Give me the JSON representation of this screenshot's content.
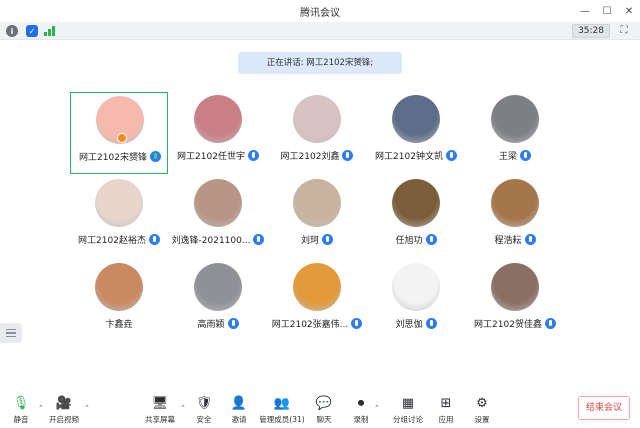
{
  "window": {
    "title": "腾讯会议"
  },
  "status": {
    "timer": "35:28"
  },
  "speaking": {
    "text": "正在讲话: 网工2102宋赟锋;"
  },
  "participants": [
    {
      "name": "网工2102宋赟锋",
      "avatar_color": "#f6b9ae",
      "mic": "green",
      "active": true,
      "host": true
    },
    {
      "name": "网工2102任世宇",
      "avatar_color": "#c97f86",
      "mic": "blue"
    },
    {
      "name": "网工2102刘鑫",
      "avatar_color": "#d8c2c2",
      "mic": "blue"
    },
    {
      "name": "网工2102钟文凯",
      "avatar_color": "#5d6d8a",
      "mic": "blue"
    },
    {
      "name": "王梁",
      "avatar_color": "#7d7f83",
      "mic": "blue"
    },
    {
      "name": "网工2102赵裕杰",
      "avatar_color": "#e8d6cd",
      "mic": "blue"
    },
    {
      "name": "刘逸锋-2021100...",
      "avatar_color": "#b89584",
      "mic": "blue"
    },
    {
      "name": "刘珂",
      "avatar_color": "#c8b49e",
      "mic": "blue"
    },
    {
      "name": "任旭功",
      "avatar_color": "#7a5e3a",
      "mic": "blue"
    },
    {
      "name": "程浩耘",
      "avatar_color": "#a5764b",
      "mic": "blue"
    },
    {
      "name": "卞鑫垚",
      "avatar_color": "#c98a62",
      "mic": "none"
    },
    {
      "name": "高雨颖",
      "avatar_color": "#8f9196",
      "mic": "blue"
    },
    {
      "name": "网工2102张嘉伟...",
      "avatar_color": "#e39a3a",
      "mic": "blue"
    },
    {
      "name": "刘思伽",
      "avatar_color": "#f4f4f4",
      "mic": "blue"
    },
    {
      "name": "网工2102贺佳鑫",
      "avatar_color": "#8a6f63",
      "mic": "blue"
    }
  ],
  "toolbar": {
    "mute": "静音",
    "video": "开启视频",
    "share": "共享屏幕",
    "security": "安全",
    "invite": "邀请",
    "members": "管理成员(31)",
    "chat": "聊天",
    "record": "录制",
    "breakout": "分组讨论",
    "apps": "应用",
    "settings": "设置",
    "end": "结束会议"
  },
  "colors": {
    "accent": "#2f7cf0",
    "active_border": "#26b36a",
    "end_red": "#e4473f"
  }
}
